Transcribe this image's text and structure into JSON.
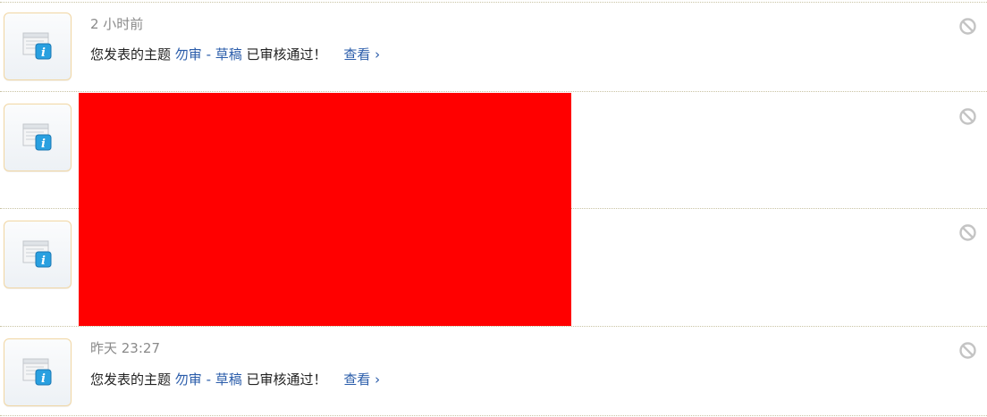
{
  "notifications": [
    {
      "time": "2 小时前",
      "prefix": "您发表的主题",
      "topic": "勿审 - 草稿",
      "suffix": "已审核通过！",
      "view": "查看 ›"
    },
    {
      "time": "",
      "prefix": "",
      "topic": "",
      "suffix": "",
      "view": ""
    },
    {
      "time": "",
      "prefix": "",
      "topic": "",
      "suffix": "",
      "view": ""
    },
    {
      "time": "昨天 23:27",
      "prefix": "您发表的主题",
      "topic": "勿审 - 草稿",
      "suffix": "已审核通过！",
      "view": "查看 ›"
    }
  ],
  "icons": {
    "notification": "info-window-icon",
    "ignore": "ignore-icon"
  },
  "colors": {
    "link": "#2a5caa",
    "time": "#8a8a8a",
    "redaction": "#ff0000",
    "icon_border": "#f1d6a2",
    "divider": "#c9c3a4"
  }
}
